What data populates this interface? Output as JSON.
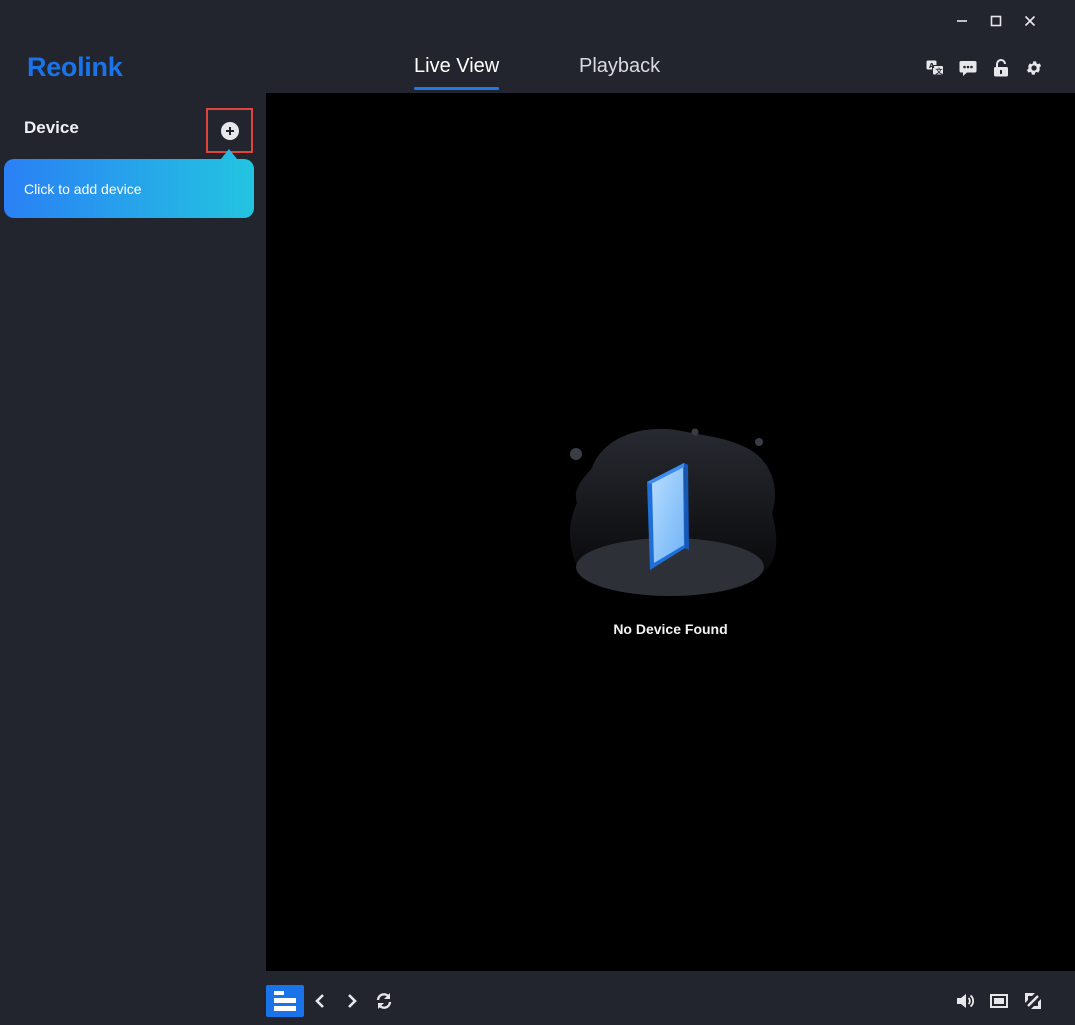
{
  "app": {
    "logo_text": "Reolink"
  },
  "window_controls": [
    "minimize-icon",
    "maximize-icon",
    "close-icon"
  ],
  "tabs": [
    {
      "label": "Live View",
      "active": true
    },
    {
      "label": "Playback",
      "active": false
    }
  ],
  "header_icons": [
    "language-icon",
    "message-icon",
    "unlock-icon",
    "gear-icon"
  ],
  "sidebar": {
    "title": "Device",
    "add_button_icon": "plus-circle-icon",
    "tooltip": "Click to add device"
  },
  "viewer": {
    "empty_message": "No Device Found"
  },
  "bottom_toolbar": {
    "left": [
      "layout-icon",
      "chevron-left-icon",
      "chevron-right-icon",
      "refresh-icon"
    ],
    "right": [
      "speaker-icon",
      "aspect-ratio-icon",
      "fullscreen-icon"
    ]
  },
  "colors": {
    "accent": "#1a73e8",
    "background": "#22252d",
    "viewer_background": "#000000",
    "highlight_border": "#e0443b",
    "tooltip_gradient_start": "#2a80f5",
    "tooltip_gradient_end": "#23c4e0"
  }
}
